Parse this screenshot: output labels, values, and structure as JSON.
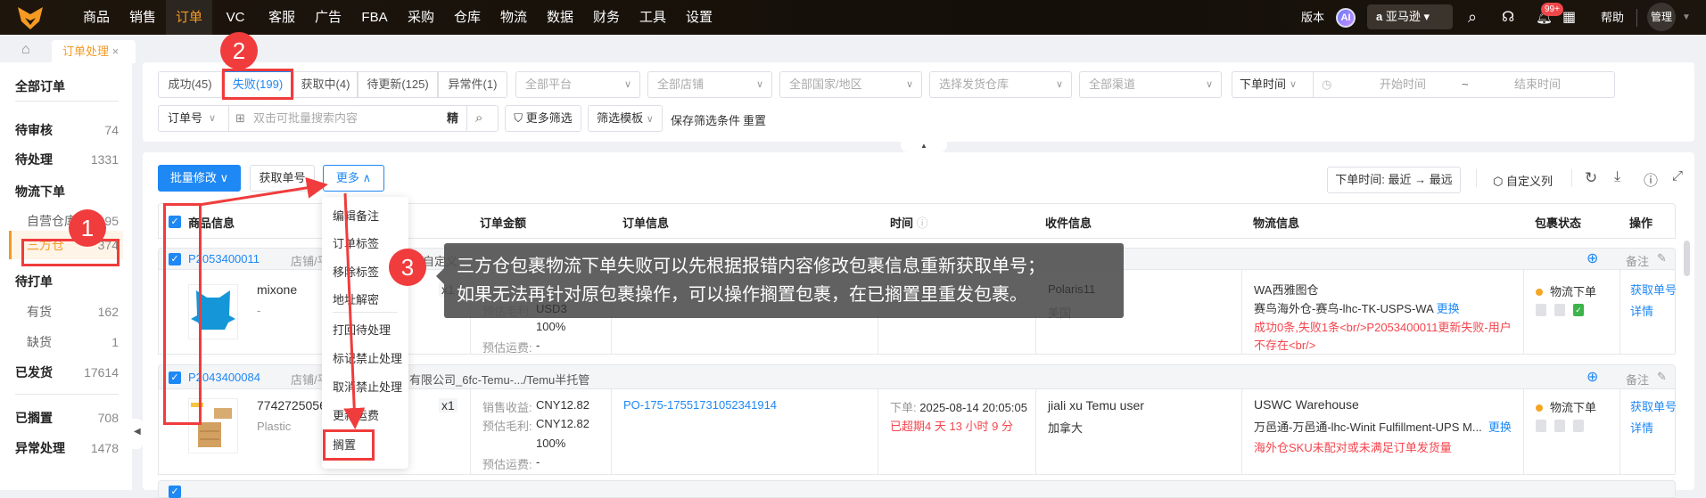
{
  "nav": {
    "items": [
      "商品",
      "销售",
      "订单",
      "VC",
      "客服",
      "广告",
      "FBA",
      "采购",
      "仓库",
      "物流",
      "数据",
      "财务",
      "工具",
      "设置"
    ],
    "active": "订单",
    "version": "版本",
    "ai": "AI",
    "store": "亚马逊",
    "notif_badge": "99+",
    "help": "帮助",
    "user": "管理"
  },
  "tabs": {
    "current": "订单处理",
    "close": "×"
  },
  "sidebar": {
    "all": "全部订单",
    "items": [
      {
        "label": "待审核",
        "count": "74"
      },
      {
        "label": "待处理",
        "count": "1331"
      },
      {
        "label": "物流下单",
        "count": ""
      },
      {
        "label": "自营仓库",
        "count": "95"
      },
      {
        "label": "三方仓",
        "count": "374"
      },
      {
        "label": "待打单",
        "count": ""
      },
      {
        "label": "有货",
        "count": "162"
      },
      {
        "label": "缺货",
        "count": "1"
      },
      {
        "label": "已发货",
        "count": "17614"
      },
      {
        "label": "已搁置",
        "count": "708"
      },
      {
        "label": "异常处理",
        "count": "1478"
      }
    ]
  },
  "filters": {
    "status_tabs": [
      "成功(45)",
      "失败(199)",
      "获取中(4)",
      "待更新(125)",
      "异常件(1)"
    ],
    "platform": "全部平台",
    "shop": "全部店铺",
    "country": "全部国家/地区",
    "warehouse": "选择发货仓库",
    "channel": "全部渠道",
    "time_type": "下单时间",
    "start": "开始时间",
    "tilde": "~",
    "end": "结束时间",
    "search_field": "订单号",
    "search_placeholder": "双击可批量搜索内容",
    "exact": "精",
    "more_filters": "更多筛选",
    "template": "筛选模板",
    "save": "保存筛选条件",
    "reset": "重置"
  },
  "toolbar": {
    "batch_edit": "批量修改",
    "get_number": "获取单号",
    "more": "更多",
    "sort": "下单时间:  最近 → 最远",
    "custom_columns": "自定义列"
  },
  "columns": [
    "商品信息",
    "订单金额",
    "订单信息",
    "时间",
    "收件信息",
    "物流信息",
    "包裹状态",
    "操作"
  ],
  "more_menu": [
    "编辑备注",
    "订单标签",
    "移除标签",
    "地址解密",
    "打回待处理",
    "标记禁止处理",
    "取消禁止处理",
    "更新运费",
    "搁置"
  ],
  "tooltip": {
    "line1": "三方仓包裹物流下单失败可以先根据报错内容修改包裹信息重新获取单号；",
    "line2": "如果无法再针对原包裹操作，可以操作搁置包裹，在已搁置里重发包裹。"
  },
  "annotations": [
    "1",
    "2",
    "3"
  ],
  "labels": {
    "revenue": "销售收益:",
    "profit": "预估毛利:",
    "shipping": "预估运费:",
    "order_time": "下单:",
    "remark": "备注",
    "change": "更换",
    "get_number": "获取单号",
    "detail": "详情"
  },
  "orders": [
    {
      "id": "P2053400011",
      "shop": "店铺/平",
      "shop_tail": "自定义",
      "product": "mixone",
      "sub": "-",
      "qty": "x1",
      "profit": "USD3",
      "margin": "100%",
      "shipping": "-",
      "recipient": "Polaris11",
      "country": "美国",
      "warehouse": "WA西雅图仓",
      "channel": "赛鸟海外仓-赛鸟-lhc-TK-USPS-WA",
      "error": "成功0条,失败1条<br/>P2053400011更新失败-用户不存在<br/>",
      "status": "物流下单"
    },
    {
      "id": "P2043400084",
      "shop": "店铺/平",
      "shop_tail": "有限公司_6fc-Temu-.../Temu半托管",
      "product": "7742725056",
      "sub": "Plastic",
      "qty": "x1",
      "revenue": "CNY12.82",
      "profit": "CNY12.82",
      "margin": "100%",
      "shipping": "-",
      "order_no": "PO-175-17551731052341914",
      "time": "2025-08-14 20:05:05",
      "overdue": "已超期4 天 13 小时 9 分",
      "recipient": "jiali xu Temu user",
      "country": "加拿大",
      "warehouse": "USWC Warehouse",
      "channel": "万邑通-万邑通-lhc-Winit Fulfillment-UPS M...",
      "error": "海外仓SKU未配对或未满足订单发货量",
      "status": "物流下单"
    }
  ]
}
